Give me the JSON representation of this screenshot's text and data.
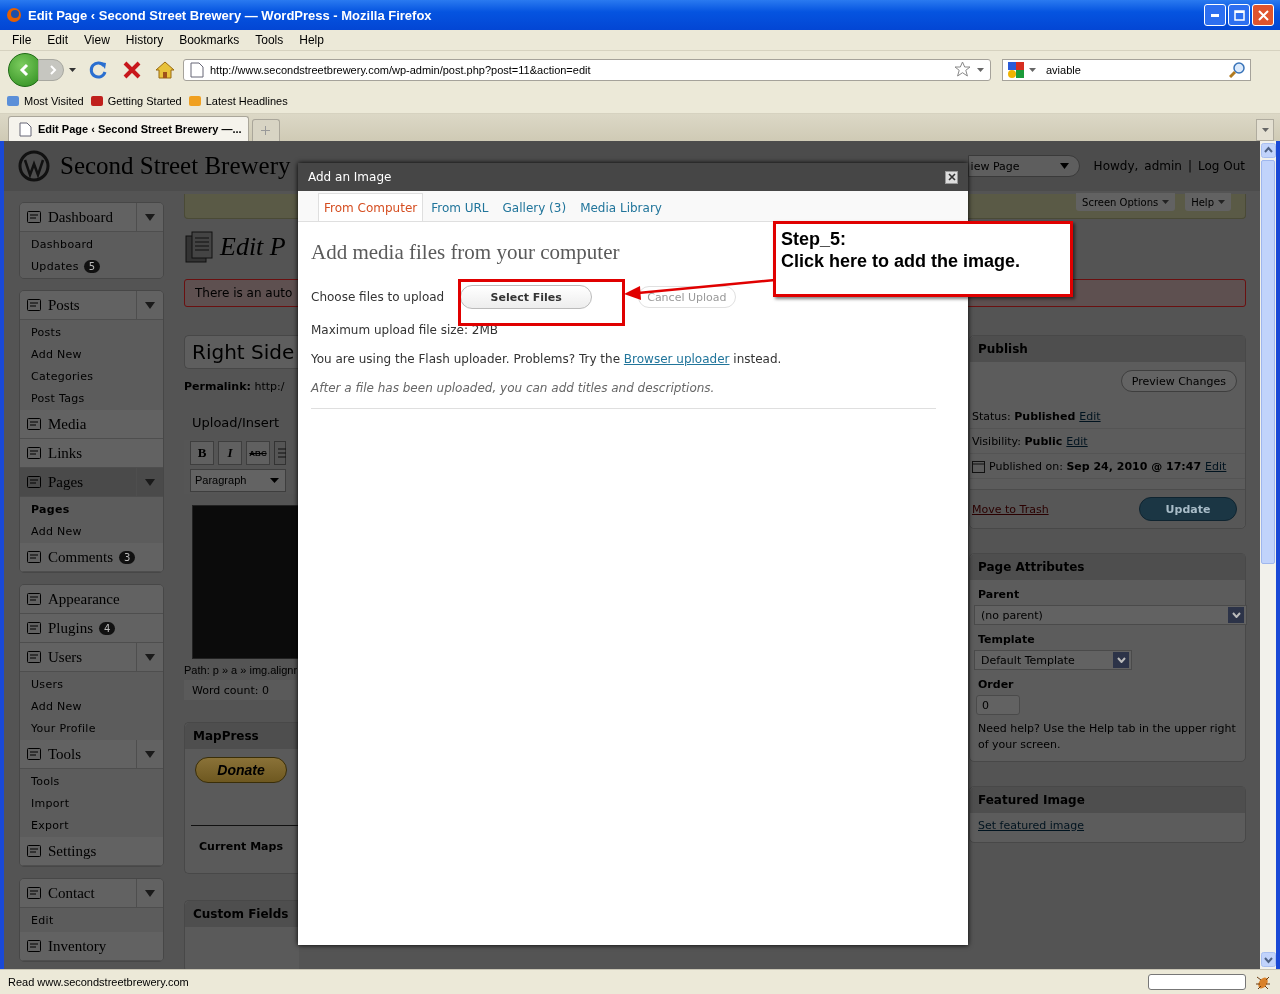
{
  "window": {
    "title": "Edit Page ‹ Second Street Brewery — WordPress - Mozilla Firefox"
  },
  "menu_bar": [
    "File",
    "Edit",
    "View",
    "History",
    "Bookmarks",
    "Tools",
    "Help"
  ],
  "address_bar": {
    "value": "http://www.secondstreetbrewery.com/wp-admin/post.php?post=11&action=edit"
  },
  "search_bar": {
    "value": "aviable"
  },
  "bookmarks": [
    "Most Visited",
    "Getting Started",
    "Latest Headlines"
  ],
  "tabs": [
    {
      "label": "Edit Page ‹ Second Street Brewery —...",
      "selected": true
    }
  ],
  "wp_header": {
    "site_title": "Second Street Brewery",
    "view_button": "iew Page",
    "greeting": "Howdy,",
    "user": "admin",
    "separator": "|",
    "logout": "Log Out"
  },
  "sidebar": {
    "sections": [
      [
        {
          "label": "Dashboard",
          "toggle": true,
          "selected": false,
          "expanded": true,
          "children": [
            {
              "label": "Dashboard",
              "selected": false
            },
            {
              "label": "Updates",
              "selected": false,
              "badge": "5"
            }
          ]
        }
      ],
      [
        {
          "label": "Posts",
          "toggle": true,
          "selected": false,
          "expanded": true,
          "children": [
            {
              "label": "Posts",
              "selected": false
            },
            {
              "label": "Add New",
              "selected": false
            },
            {
              "label": "Categories",
              "selected": false
            },
            {
              "label": "Post Tags",
              "selected": false
            }
          ]
        },
        {
          "label": "Media",
          "toggle": false,
          "selected": false
        },
        {
          "label": "Links",
          "toggle": false,
          "selected": false
        },
        {
          "label": "Pages",
          "toggle": true,
          "selected": true,
          "expanded": true,
          "children": [
            {
              "label": "Pages",
              "selected": true
            },
            {
              "label": "Add New",
              "selected": false
            }
          ]
        },
        {
          "label": "Comments",
          "toggle": false,
          "selected": false,
          "badge": "3"
        }
      ],
      [
        {
          "label": "Appearance",
          "toggle": false,
          "selected": false
        },
        {
          "label": "Plugins",
          "toggle": false,
          "selected": false,
          "badge": "4"
        },
        {
          "label": "Users",
          "toggle": true,
          "selected": false,
          "expanded": true,
          "children": [
            {
              "label": "Users",
              "selected": false
            },
            {
              "label": "Add New",
              "selected": false
            },
            {
              "label": "Your Profile",
              "selected": false
            }
          ]
        },
        {
          "label": "Tools",
          "toggle": true,
          "selected": false,
          "expanded": true,
          "children": [
            {
              "label": "Tools",
              "selected": false
            },
            {
              "label": "Import",
              "selected": false
            },
            {
              "label": "Export",
              "selected": false
            }
          ]
        },
        {
          "label": "Settings",
          "toggle": false,
          "selected": false
        }
      ],
      [
        {
          "label": "Contact",
          "toggle": true,
          "selected": false,
          "expanded": true,
          "children": [
            {
              "label": "Edit",
              "selected": false
            }
          ]
        },
        {
          "label": "Inventory",
          "toggle": false,
          "selected": false
        }
      ]
    ]
  },
  "screen_meta": [
    "Screen Options",
    "Help"
  ],
  "editor": {
    "heading": "Edit P",
    "notice": "There is an auto",
    "title_value": "Right Side",
    "permalink": "**Permalink:** http:/",
    "upload_label": "Upload/Insert",
    "toolbar": [
      "B",
      "I",
      "ABC"
    ],
    "format": "Paragraph",
    "path": "Path: p » a » img.alignr",
    "word_count": "Word count: 0"
  },
  "mappress": {
    "title": "MapPress",
    "donate": "Donate",
    "current_maps": "Current Maps"
  },
  "custom_fields": {
    "title": "Custom Fields"
  },
  "publish": {
    "title": "Publish",
    "preview": "Preview Changes",
    "rows": [
      {
        "kind": "text",
        "text": "Status: **Published**",
        "link": "Edit"
      },
      {
        "kind": "text",
        "text": "Visibility: **Public**",
        "link": "Edit"
      },
      {
        "kind": "date",
        "text": "Published on: **Sep 24, 2010 @ 17:47**",
        "link": "Edit"
      }
    ],
    "trash": "Move to Trash",
    "update": "Update"
  },
  "page_attributes": {
    "title": "Page Attributes",
    "parent_label": "Parent",
    "parent_value": "(no parent)",
    "template_label": "Template",
    "template_value": "Default Template",
    "order_label": "Order",
    "order_value": "0",
    "help": "Need help? Use the Help tab in the upper right of your screen."
  },
  "featured_image": {
    "title": "Featured Image",
    "link": "Set featured image"
  },
  "dialog": {
    "title": "Add an Image",
    "tabs": [
      {
        "label": "From Computer",
        "selected": true
      },
      {
        "label": "From URL",
        "selected": false
      },
      {
        "label": "Gallery (3)",
        "selected": false
      },
      {
        "label": "Media Library",
        "selected": false
      }
    ],
    "heading": "Add media files from your computer",
    "choose_label": "Choose files to upload",
    "select_button": "Select Files",
    "cancel_button": {
      "label": "Cancel Upload",
      "disabled": true
    },
    "max_size": "Maximum upload file size: 2MB",
    "flash_before": "You are using the Flash uploader. Problems? Try the",
    "flash_link": "Browser uploader",
    "flash_after": "instead.",
    "note": "After a file has been uploaded, you can add titles and descriptions."
  },
  "callout": {
    "lines": [
      "Step_5:",
      "Click here to add the image."
    ]
  },
  "status_bar": {
    "text": "Read www.secondstreetbrewery.com"
  }
}
